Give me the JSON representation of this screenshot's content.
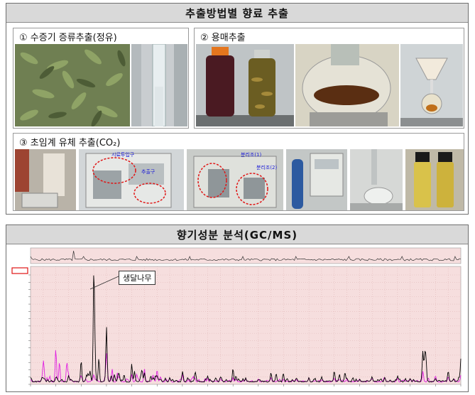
{
  "extraction": {
    "title": "추출방법별 향료 추출",
    "sections": [
      {
        "label": "① 수증기 증류추출(정유)"
      },
      {
        "label": "② 용매추출"
      },
      {
        "label": "③ 초임계 유체 추출(CO₂)"
      }
    ],
    "photo_tags": [
      "시료투입구",
      "추출구",
      "분리조(1)",
      "분리조(2)"
    ]
  },
  "analysis": {
    "title": "향기성분 분석(GC/MS)",
    "callout": "생달나무"
  },
  "colors": {
    "chart_bg": "#f6dede",
    "trace_main": "#000000",
    "trace_secondary": "#e020e0",
    "title_bg": "#d9d9d9"
  },
  "chart_data": [
    {
      "type": "line",
      "series": [
        {
          "values": [
            0.05,
            0.05,
            0.06,
            0.05,
            0.3,
            1.45,
            0.2,
            0.1,
            0.25,
            0.12,
            0.08,
            0.05,
            0.08,
            0.1,
            0.05,
            0.04,
            0.18,
            0.04,
            0.03,
            0.12,
            0.05,
            0.03,
            0.06,
            0.03,
            0.15,
            0.05,
            0.03,
            0.06,
            0.04,
            0.08,
            0.05,
            0.4,
            0.05,
            0.12,
            0.2
          ]
        },
        {
          "values": [
            0.03,
            0.2,
            0.45,
            0.08,
            0.05,
            0.1,
            0.3,
            0.05,
            0.1,
            0.18,
            0.06,
            0.04,
            0.1,
            0.05,
            0.04,
            0.03,
            0.05,
            0.03,
            0.02,
            0.05,
            0.03,
            0.02,
            0.03,
            0.02,
            0.05,
            0.03,
            0.02,
            0.04,
            0.02,
            0.05,
            0.03,
            0.1,
            0.03,
            0.05,
            0.08
          ]
        }
      ],
      "x": [
        20,
        25,
        30,
        35,
        40,
        45,
        50,
        55,
        60,
        65,
        70,
        75,
        80,
        85,
        90,
        95,
        100,
        105,
        110,
        115,
        120,
        125,
        130,
        135,
        140,
        145,
        150,
        155,
        160,
        165,
        170,
        175,
        180,
        185,
        190
      ],
      "xlim": [
        20,
        190
      ],
      "ylim": [
        0,
        1.5
      ],
      "grid": true
    }
  ]
}
